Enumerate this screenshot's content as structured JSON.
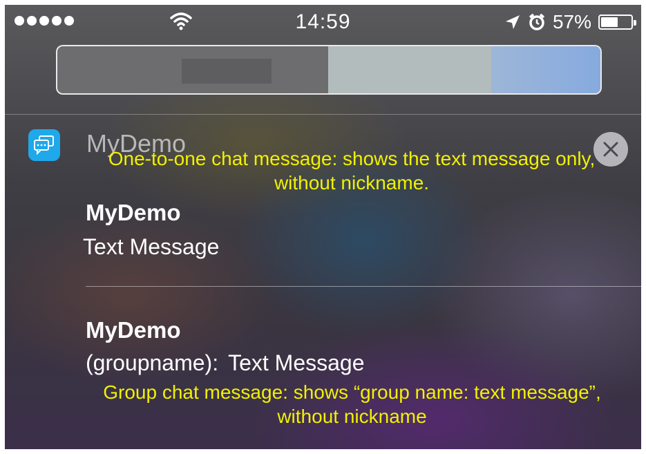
{
  "status_bar": {
    "time": "14:59",
    "battery_percent": "57%",
    "battery_level": 0.57,
    "signal_dots": 5
  },
  "notification": {
    "app_name": "MyDemo",
    "app_icon": "chat-bubble-icon",
    "close_icon": "close-icon",
    "accent_color": "#1fa8ea"
  },
  "messages": [
    {
      "title": "MyDemo",
      "body": "Text Message"
    },
    {
      "title": "MyDemo",
      "group_prefix": "(groupname):",
      "body": "Text Message"
    }
  ],
  "annotations": {
    "one_to_one": "One-to-one chat message: shows the text message only, without nickname.",
    "group": "Group chat message: shows “group name: text message”, without nickname",
    "color": "#f1f100"
  }
}
